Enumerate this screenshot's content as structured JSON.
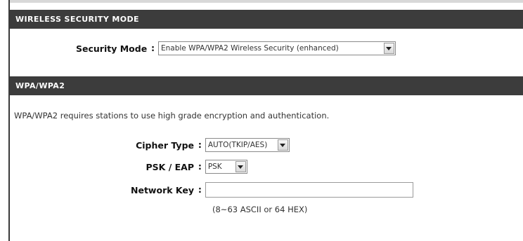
{
  "wireless_security": {
    "header": "WIRELESS SECURITY MODE",
    "security_mode_label": "Security Mode",
    "security_mode_value": "Enable WPA/WPA2 Wireless Security (enhanced)"
  },
  "wpa": {
    "header": "WPA/WPA2",
    "description": "WPA/WPA2 requires stations to use high grade encryption and authentication.",
    "cipher_type_label": "Cipher Type",
    "cipher_type_value": "AUTO(TKIP/AES)",
    "psk_eap_label": "PSK / EAP",
    "psk_eap_value": "PSK",
    "network_key_label": "Network Key",
    "network_key_value": "",
    "network_key_hint": "(8~63 ASCII or 64 HEX)"
  },
  "colors": {
    "header_bg": "#3c3c3c",
    "header_text": "#ffffff"
  },
  "icons": {
    "dropdown": "chevron-down-icon"
  },
  "separator": ":"
}
